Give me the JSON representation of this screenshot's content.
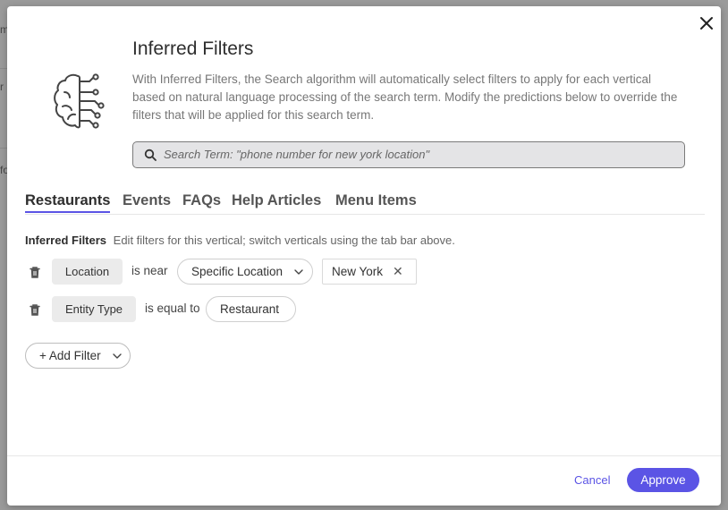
{
  "background": {
    "fragments": [
      "m",
      "r",
      "fo"
    ]
  },
  "modal": {
    "title": "Inferred Filters",
    "description": "With Inferred Filters, the Search algorithm will automatically select filters to apply for each vertical based on natural language processing of the search term. Modify the predictions below to override the filters that will be applied for this search term.",
    "search_placeholder": "Search Term: \"phone number for new york location\"",
    "tabs": [
      "Restaurants",
      "Events",
      "FAQs",
      "Help Articles",
      "Menu Items"
    ],
    "active_tab": "Restaurants",
    "section_label": "Inferred Filters",
    "section_hint": "Edit filters for this vertical; switch verticals using the tab bar above.",
    "filters": [
      {
        "field": "Location",
        "operator": "is near",
        "select_value": "Specific Location",
        "value": "New York"
      },
      {
        "field": "Entity Type",
        "operator": "is equal to",
        "select_value": "Restaurant"
      }
    ],
    "add_filter_label": "+ Add Filter",
    "cancel_label": "Cancel",
    "approve_label": "Approve"
  },
  "icons": {
    "close": "close-icon",
    "brain": "brain-circuit-icon",
    "search": "search-icon",
    "trash": "trash-icon",
    "chevron": "chevron-down-icon",
    "remove": "remove-x-icon"
  },
  "colors": {
    "accent": "#5b54e5",
    "overlay": "#9a9a9a",
    "chip": "#ebebeb"
  }
}
